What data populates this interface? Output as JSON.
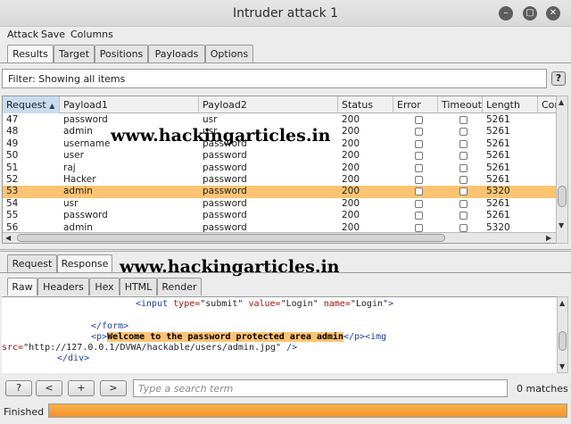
{
  "window": {
    "title": "Intruder attack 1",
    "controls": [
      "minimize-icon",
      "maximize-icon",
      "close-icon"
    ]
  },
  "menu": [
    "Attack",
    "Save",
    "Columns"
  ],
  "main_tabs": [
    {
      "label": "Results",
      "active": true
    },
    {
      "label": "Target",
      "active": false
    },
    {
      "label": "Positions",
      "active": false
    },
    {
      "label": "Payloads",
      "active": false
    },
    {
      "label": "Options",
      "active": false
    }
  ],
  "filter": {
    "text": "Filter: Showing all items",
    "help_label": "?"
  },
  "table": {
    "columns": [
      "Request",
      "Payload1",
      "Payload2",
      "Status",
      "Error",
      "Timeout",
      "Length",
      "Cor"
    ],
    "sort_column": "Request",
    "sort_indicator": "▲",
    "rows": [
      {
        "request": "47",
        "payload1": "password",
        "payload2": "usr",
        "status": "200",
        "length": "5261",
        "selected": false
      },
      {
        "request": "48",
        "payload1": "admin",
        "payload2": "usr",
        "status": "200",
        "length": "5261",
        "selected": false
      },
      {
        "request": "49",
        "payload1": "username",
        "payload2": "password",
        "status": "200",
        "length": "5261",
        "selected": false
      },
      {
        "request": "50",
        "payload1": "user",
        "payload2": "password",
        "status": "200",
        "length": "5261",
        "selected": false
      },
      {
        "request": "51",
        "payload1": "raj",
        "payload2": "password",
        "status": "200",
        "length": "5261",
        "selected": false
      },
      {
        "request": "52",
        "payload1": "Hacker",
        "payload2": "password",
        "status": "200",
        "length": "5261",
        "selected": false
      },
      {
        "request": "53",
        "payload1": "admin",
        "payload2": "password",
        "status": "200",
        "length": "5320",
        "selected": true
      },
      {
        "request": "54",
        "payload1": "usr",
        "payload2": "password",
        "status": "200",
        "length": "5261",
        "selected": false
      },
      {
        "request": "55",
        "payload1": "password",
        "payload2": "password",
        "status": "200",
        "length": "5261",
        "selected": false
      },
      {
        "request": "56",
        "payload1": "admin",
        "payload2": "password",
        "status": "200",
        "length": "5320",
        "selected": false
      }
    ]
  },
  "watermark": "www.hackingarticles.in",
  "detail_tabs": [
    {
      "label": "Request",
      "active": false
    },
    {
      "label": "Response",
      "active": true
    }
  ],
  "view_tabs": [
    {
      "label": "Raw",
      "active": true
    },
    {
      "label": "Headers",
      "active": false
    },
    {
      "label": "Hex",
      "active": false
    },
    {
      "label": "HTML",
      "active": false
    },
    {
      "label": "Render",
      "active": false
    }
  ],
  "response_code": {
    "line1_tag_open": "<input ",
    "line1_attr1": "type=",
    "line1_val1": "\"submit\" ",
    "line1_attr2": "value=",
    "line1_val2": "\"Login\" ",
    "line1_attr3": "name=",
    "line1_val3": "\"Login\"",
    "line1_tag_close": ">",
    "line2": "</form>",
    "line3_open": "<p>",
    "line3_highlight": "Welcome to the password protected area admin",
    "line3_close": "</p><img",
    "line4_attr": "src=",
    "line4_val": "\"http://127.0.0.1/DVWA/hackable/users/admin.jpg\"",
    "line4_close": " />",
    "line5": "</div>"
  },
  "search": {
    "help_label": "?",
    "prev_label": "<",
    "add_label": "+",
    "next_label": ">",
    "placeholder": "Type a search term",
    "matches": "0 matches"
  },
  "status": {
    "text": "Finished",
    "progress": 1.0
  }
}
